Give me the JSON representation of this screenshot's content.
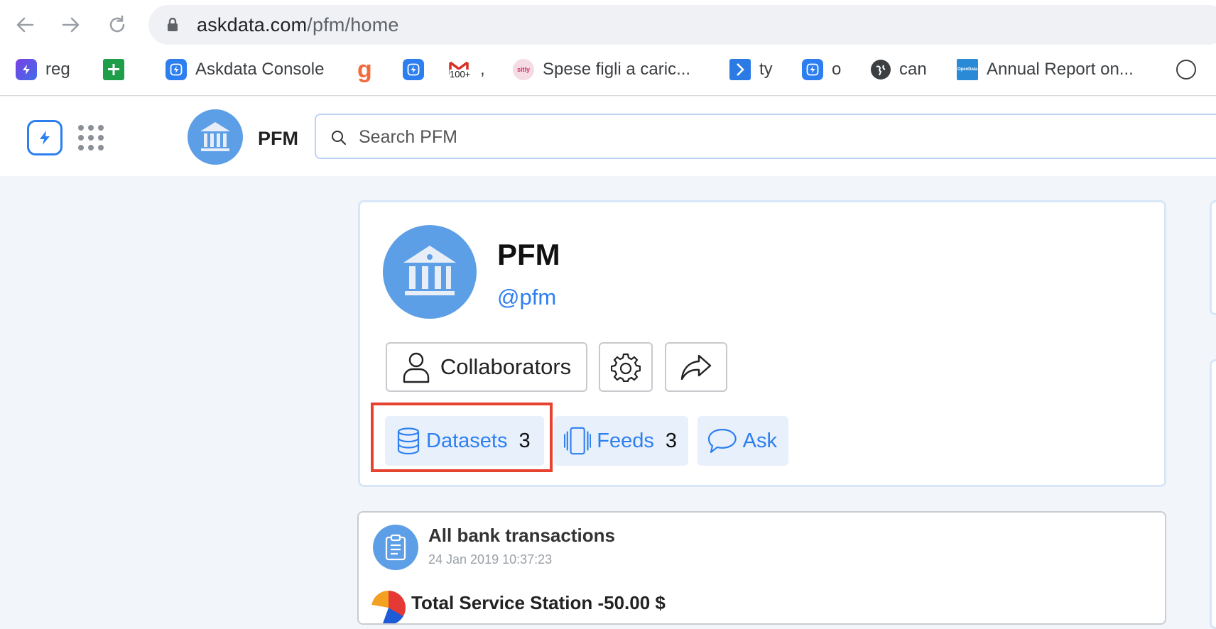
{
  "browser": {
    "url_host": "askdata.com",
    "url_path": "/pfm/home",
    "bookmarks": [
      {
        "label": "reg",
        "icon": "instagram-icon"
      },
      {
        "label": "",
        "icon": "google-sheets-icon"
      },
      {
        "label": "Askdata Console",
        "icon": "askdata-icon"
      },
      {
        "label": "",
        "icon": "g-logo-icon"
      },
      {
        "label": "",
        "icon": "askdata-icon"
      },
      {
        "label": ",",
        "icon": "gmail-icon",
        "badge": "100+"
      },
      {
        "label": "Spese figli a caric...",
        "icon": "sitly-icon",
        "icon_text": "sitly"
      },
      {
        "label": "ty",
        "icon": "chevron-app-icon"
      },
      {
        "label": "o",
        "icon": "askdata-icon"
      },
      {
        "label": "can",
        "icon": "globe-icon"
      },
      {
        "label": "Annual Report on...",
        "icon": "opendata-icon",
        "icon_text": "OpenData"
      },
      {
        "label": "",
        "icon": "circle-icon"
      }
    ]
  },
  "app": {
    "workspace_name": "PFM",
    "search_placeholder": "Search PFM"
  },
  "profile": {
    "name": "PFM",
    "handle": "@pfm",
    "collaborators_label": "Collaborators",
    "tabs": {
      "datasets_label": "Datasets",
      "datasets_count": "3",
      "feeds_label": "Feeds",
      "feeds_count": "3",
      "ask_label": "Ask"
    }
  },
  "feed": {
    "title": "All bank transactions",
    "date": "24 Jan 2019 10:37:23",
    "tx_text": "Total Service Station -50.00 $"
  },
  "colors": {
    "accent": "#2d7ff0",
    "avatar_bg": "#5d9fe6",
    "highlight": "#e5432f"
  }
}
